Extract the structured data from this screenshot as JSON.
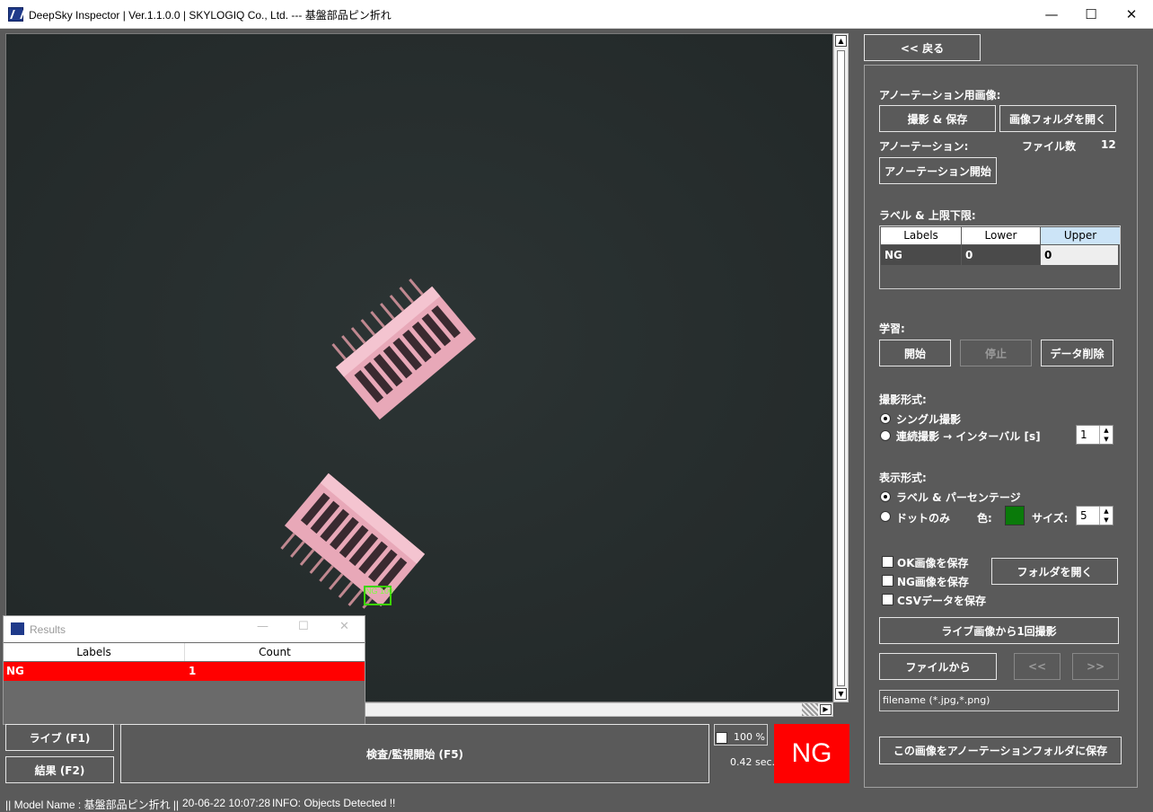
{
  "window": {
    "title": "DeepSky Inspector | Ver.1.1.0.0 | SKYLOGIQ Co., Ltd. --- 基盤部品ピン折れ",
    "minimize": "—",
    "maximize": "☐",
    "close": "✕"
  },
  "viewer": {
    "detection_label": "NG 100",
    "scroll_up": "▲",
    "scroll_down": "▼",
    "scroll_left": "◀",
    "scroll_right": "▶"
  },
  "results_window": {
    "title": "Results",
    "columns": [
      "Labels",
      "Count"
    ],
    "rows": [
      {
        "label": "NG",
        "count": "1"
      }
    ],
    "minimize": "—",
    "maximize": "☐",
    "close": "✕"
  },
  "bottom": {
    "live_button": "ライブ (F1)",
    "results_button": "結果 (F2)",
    "inspect_button": "検査/監視開始 (F5)",
    "zoom_label": "100 %",
    "elapsed": "0.42 sec.",
    "verdict": "NG",
    "verdict_color": "#ff0000"
  },
  "right_panel": {
    "back_button": "<< 戻る",
    "annotation_image_label": "アノーテーション用画像:",
    "capture_save_button": "撮影 & 保存",
    "open_image_folder_button": "画像フォルダを開く",
    "annotation_label": "アノーテーション:",
    "file_count_label": "ファイル数",
    "file_count_value": "12",
    "annotation_start_button": "アノーテーション開始",
    "label_limits_label": "ラベル & 上限下限:",
    "label_table": {
      "headers": [
        "Labels",
        "Lower",
        "Upper"
      ],
      "rows": [
        {
          "label": "NG",
          "lower": "0",
          "upper": "0"
        }
      ]
    },
    "learning_label": "学習:",
    "start_button": "開始",
    "stop_button": "停止",
    "delete_data_button": "データ削除",
    "capture_mode_label": "撮影形式:",
    "single_capture": "シングル撮影",
    "continuous_capture": "連続撮影 → インターバル [s]",
    "interval_value": "1",
    "display_mode_label": "表示形式:",
    "label_percentage": "ラベル & パーセンテージ",
    "dot_only": "ドットのみ",
    "color_label": "色:",
    "dot_color": "#0a7a0a",
    "size_label": "サイズ:",
    "size_value": "5",
    "save_ok": "OK画像を保存",
    "save_ng": "NG画像を保存",
    "save_csv": "CSVデータを保存",
    "open_folder_button": "フォルダを開く",
    "capture_once_button": "ライブ画像から1回撮影",
    "from_file_button": "ファイルから",
    "prev_button": "<<",
    "next_button": ">>",
    "filename_field": "filename (*.jpg,*.png)",
    "save_to_annotation_button": "この画像をアノーテーションフォルダに保存"
  },
  "status": {
    "model": "|| Model Name : 基盤部品ピン折れ ||",
    "timestamp": "20-06-22 10:07:28",
    "info": "INFO:   Objects Detected !!"
  }
}
